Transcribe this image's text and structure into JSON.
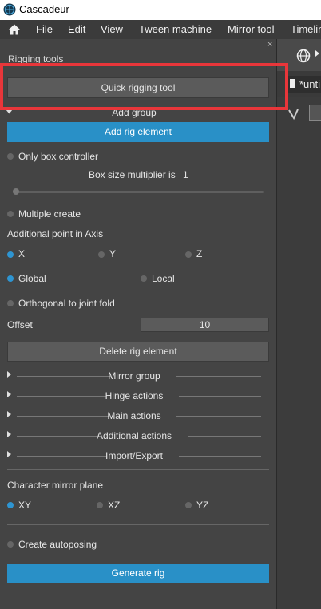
{
  "titlebar": {
    "title": "Cascadeur"
  },
  "menu": {
    "items": [
      "File",
      "Edit",
      "View",
      "Tween machine",
      "Mirror tool",
      "Timelin"
    ]
  },
  "panel": {
    "title": "Rigging tools",
    "close": "×",
    "quick_rigging_btn": "Quick rigging tool",
    "add_group": "Add group",
    "add_rig_element_btn": "Add rig element",
    "only_box": "Only box controller",
    "box_size_label": "Box size multiplier is",
    "box_size_value": "1",
    "box_size_slider_fraction": 0,
    "multiple_create": "Multiple create",
    "additional_point": "Additional point in Axis",
    "axis": [
      "X",
      "Y",
      "Z"
    ],
    "space": [
      "Global",
      "Local"
    ],
    "orthogonal": "Orthogonal to joint fold",
    "offset_label": "Offset",
    "offset_value": "10",
    "delete_btn": "Delete rig element",
    "groups": [
      "Mirror group",
      "Hinge actions",
      "Main actions",
      "Additional actions",
      "Import/Export"
    ],
    "char_mirror_plane": "Character mirror plane",
    "planes": [
      "XY",
      "XZ",
      "YZ"
    ],
    "create_autoposing": "Create autoposing",
    "generate_btn": "Generate rig"
  },
  "right": {
    "tab_label": "*unti"
  }
}
